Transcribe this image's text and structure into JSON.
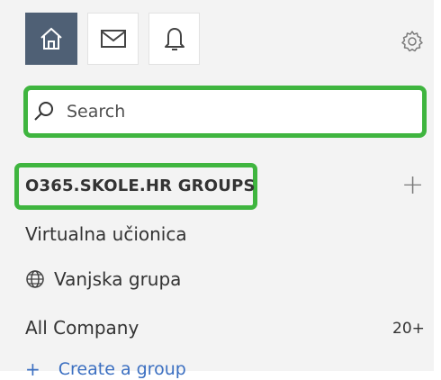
{
  "topbar": {
    "icons": [
      "home-icon",
      "mail-icon",
      "bell-icon",
      "gear-icon"
    ],
    "active": "home",
    "active_color": "#4f6075"
  },
  "search": {
    "placeholder": "Search",
    "value": "",
    "highlight_color": "#3fb53f"
  },
  "groups": {
    "header": "O365.SKOLE.HR GROUPS",
    "add_label": "+",
    "items": [
      {
        "label": "Virtualna učionica"
      },
      {
        "label": "Vanjska grupa",
        "icon": "globe-icon"
      },
      {
        "label": "All Company",
        "count": "20+"
      }
    ],
    "create_prefix": "+",
    "create_label": "Create a group",
    "create_color": "#3b6fc1"
  }
}
